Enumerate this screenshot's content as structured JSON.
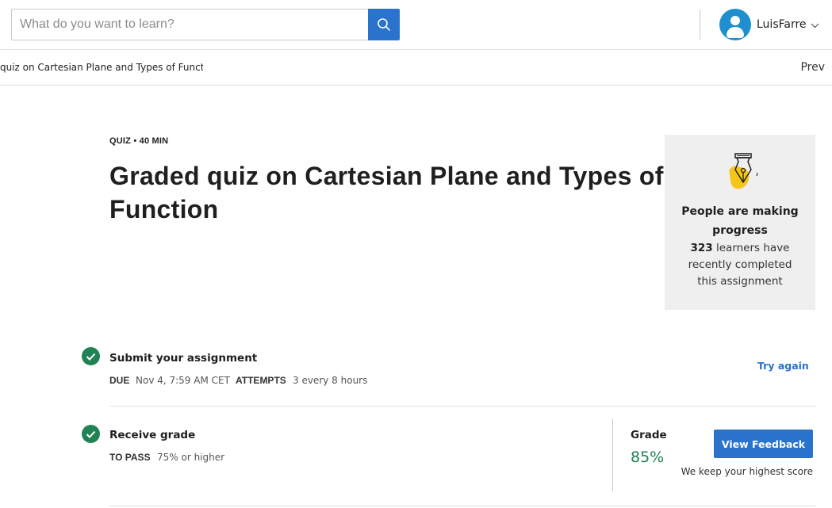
{
  "header": {
    "search_placeholder": "What do you want to learn?",
    "search_icon": "magnifier-icon",
    "user": {
      "name": "LuisFarre",
      "avatar_icon": "user-avatar-icon",
      "menu_icon": "chevron-down-icon"
    }
  },
  "breadcrumb": {
    "title": "quiz on Cartesian Plane and Types of Functior",
    "prev_label": "Prev"
  },
  "main": {
    "kicker": "QUIZ • 40 MIN",
    "title": "Graded quiz on Cartesian Plane and Types of Function"
  },
  "progress_card": {
    "icon": "pen-nib-icon",
    "heading": "People are making progress",
    "learner_count": "323",
    "text": "learners have recently completed this assignment"
  },
  "submit": {
    "icon": "check-circle-icon",
    "title": "Submit your assignment",
    "due_label": "DUE",
    "due_value": "Nov 4, 7:59 AM CET",
    "attempts_label": "ATTEMPTS",
    "attempts_value": "3 every 8 hours",
    "action_label": "Try again"
  },
  "receive": {
    "icon": "check-circle-icon",
    "title": "Receive grade",
    "pass_label": "TO PASS",
    "pass_value": "75% or higher",
    "grade_label": "Grade",
    "grade_value": "85%",
    "feedback_button": "View Feedback",
    "note": "We keep your highest score"
  },
  "colors": {
    "primary": "#2a73cc",
    "success": "#1f8354",
    "avatar": "#1f8fcf",
    "card_bg": "#efefef",
    "icon_yellow": "#f5c518"
  }
}
